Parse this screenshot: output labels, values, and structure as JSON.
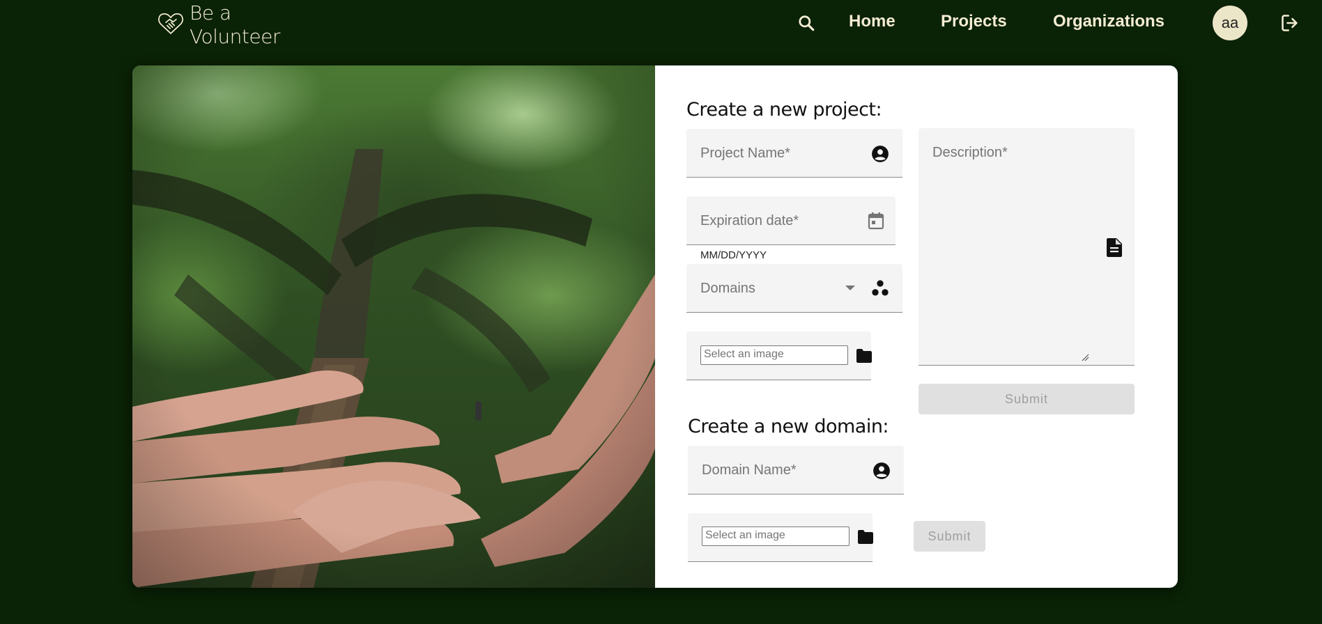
{
  "header": {
    "logo_text_line1": "Be a",
    "logo_text_line2": "Volunteer",
    "logo_icon": "heart-handshake-icon",
    "search_icon": "search-icon",
    "nav": [
      {
        "label": "Home"
      },
      {
        "label": "Projects"
      },
      {
        "label": "Organizations"
      }
    ],
    "avatar_initials": "aa",
    "logout_icon": "logout-icon"
  },
  "photo": {
    "subject": "hands-on-tree-trunk"
  },
  "project_form": {
    "title": "Create a new project:",
    "project_name_placeholder": "Project Name*",
    "expiration_placeholder": "Expiration date*",
    "expiration_helper": "MM/DD/YYYY",
    "domains_placeholder": "Domains",
    "image_placeholder": "Select an image",
    "description_placeholder": "Description*",
    "submit_label": "Submit"
  },
  "domain_form": {
    "title": "Create a new domain:",
    "domain_name_placeholder": "Domain Name*",
    "image_placeholder": "Select an image",
    "submit_label": "Submit"
  },
  "colors": {
    "background": "#0a2205",
    "header_text": "#f3ecd2",
    "avatar_bg": "#ece6c8",
    "field_bg": "#f4f4f4",
    "button_disabled_bg": "#e0e0e0",
    "button_disabled_text": "#9e9e9e"
  }
}
